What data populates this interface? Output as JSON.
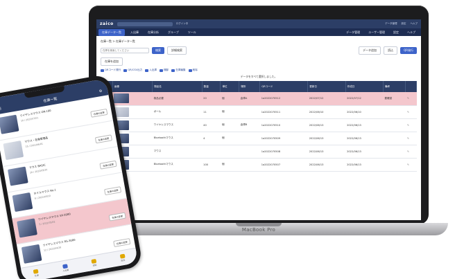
{
  "laptop": {
    "brand": "MacBook Pro",
    "app": {
      "logo": "zaico",
      "top_left_text": "ログイン中",
      "top_right": [
        "データ管理",
        "設定",
        "ヘルプ"
      ],
      "nav": [
        "在庫データ一覧",
        "入出庫",
        "在庫分析",
        "グループ",
        "ツール"
      ],
      "nav_right": [
        "データ管理",
        "ユーザー管理",
        "設定",
        "ヘルプ"
      ],
      "breadcrumb": "在庫一覧 > 在庫データ一覧",
      "search_placeholder": "在庫を検索してください",
      "search_button": "検索",
      "filter_button": "詳細検索",
      "action_buttons": [
        "データ追加",
        "読込",
        "QR発行"
      ],
      "add_button": "在庫を追加",
      "tools": [
        "QRコード発行",
        "QR/CSV出力",
        "入出庫",
        "棚卸",
        "在庫編集",
        "削除"
      ],
      "info_text": "データをすべて選択しました。",
      "columns": [
        "画像",
        "物品名",
        "数量",
        "単位",
        "場所",
        "カテゴリ",
        "QRコード",
        "更新日",
        "作成日",
        "備考"
      ],
      "rows": [
        {
          "name": "検品必要",
          "qty": "20",
          "unit": "個",
          "place": "倉庫A",
          "code": "1a2022070512",
          "date": "2022/07/12",
          "created": "2022/07/12",
          "note": "要確認"
        },
        {
          "name": "ボール",
          "qty": "11",
          "unit": "個",
          "place": "",
          "code": "1a2022070511",
          "date": "2022/06/10",
          "created": "2022/06/10",
          "note": ""
        },
        {
          "name": "ワイヤレスマウス",
          "qty": "40",
          "unit": "個",
          "place": "倉庫B",
          "code": "1a2022070510",
          "date": "2022/06/13",
          "created": "2022/06/13",
          "note": ""
        },
        {
          "name": "Bluetoothマウス",
          "qty": "4",
          "unit": "個",
          "place": "",
          "code": "1a2022070509",
          "date": "2022/06/13",
          "created": "2022/06/13",
          "note": ""
        },
        {
          "name": "マウス",
          "qty": "",
          "unit": "",
          "place": "",
          "code": "1a2022070508",
          "date": "2022/06/13",
          "created": "2022/06/13",
          "note": ""
        },
        {
          "name": "Bluetoothマウス",
          "qty": "100",
          "unit": "個",
          "place": "",
          "code": "1a2022070507",
          "date": "2022/06/13",
          "created": "2022/06/13",
          "note": ""
        }
      ]
    }
  },
  "phone": {
    "title": "在庫一覧",
    "items": [
      {
        "name": "ワイヤレスマウス OR-100",
        "sub": "10 / 2022/07/01",
        "button": "在庫の変更"
      },
      {
        "name": "マウス・在庫管理品",
        "sub": "15 / 2022/06/01",
        "button": "在庫の変更"
      },
      {
        "name": "マウス BASIC",
        "sub": "20 / 2022/05/20",
        "button": "在庫の変更"
      },
      {
        "name": "ホイルマウス No.1",
        "sub": "8 / 2022/05/10",
        "button": "在庫の変更"
      },
      {
        "name": "ワイヤレスマウス SX-2000",
        "sub": "5 / 2022/05/02",
        "button": "在庫の変更"
      },
      {
        "name": "ワイヤレスマウス RS-3000",
        "sub": "12 / 2022/04/28",
        "button": "在庫の変更"
      }
    ],
    "tabs": [
      "在庫",
      "入出庫",
      "読取",
      "設定"
    ]
  }
}
